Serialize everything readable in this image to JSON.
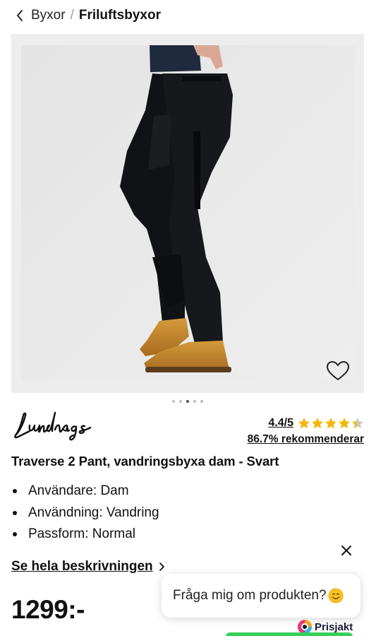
{
  "breadcrumb": {
    "back_icon": "chevron-left-icon",
    "parent": "Byxor",
    "separator": "/",
    "current": "Friluftsbyxor"
  },
  "gallery": {
    "image_alt": "Traverse 2 Pant, vandringsbyxa dam - Svart",
    "favorite_icon": "heart-outline-icon",
    "slide_count": 5,
    "active_slide": 3
  },
  "brand": {
    "logo_text": "Lundhags"
  },
  "rating": {
    "score": "4.4/5",
    "stars_value": 4.4,
    "stars_max": 5,
    "star_color": "#f3b600",
    "recommend": "86.7% rekommenderar"
  },
  "product": {
    "title": "Traverse 2 Pant, vandringsbyxa dam - Svart",
    "specs": [
      "Användare: Dam",
      "Användning: Vandring",
      "Passform: Normal"
    ],
    "description_link": "Se hela beskrivningen",
    "price": "1299:-"
  },
  "chat": {
    "close_icon": "close-icon",
    "prompt": "Fråga mig om produkten?",
    "emoji": "smiling-face-icon"
  },
  "footer": {
    "prisjakt_label": "Prisjakt",
    "accent_green": "#34d058"
  }
}
